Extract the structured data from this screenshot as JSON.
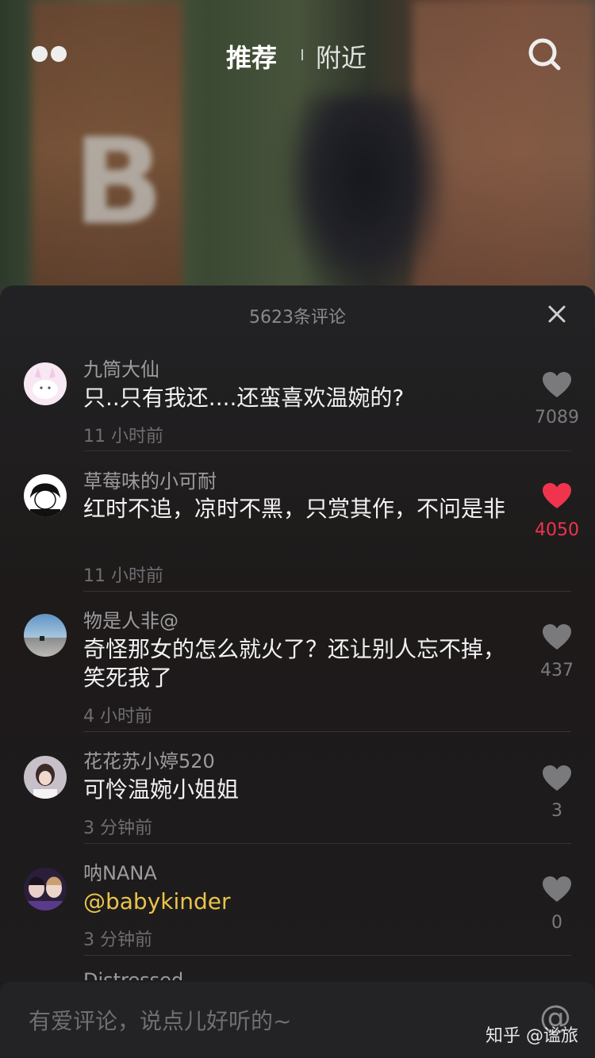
{
  "nav": {
    "tab_recommend": "推荐",
    "tab_nearby": "附近",
    "menu_icon": "dots-icon",
    "search_icon": "search-icon"
  },
  "comments_panel": {
    "title": "5623条评论",
    "close_icon": "close-icon",
    "items": [
      {
        "user": "九筒大仙",
        "text": "只..只有我还....还蛮喜欢温婉的?",
        "time": "11 小时前",
        "likes": "7089",
        "liked": false
      },
      {
        "user": "草莓味的小可耐",
        "text": "红时不追，凉时不黑，只赏其作，不问是非",
        "time": "11 小时前",
        "likes": "4050",
        "liked": true
      },
      {
        "user": "物是人非@",
        "text": "奇怪那女的怎么就火了？还让别人忘不掉，笑死我了",
        "time": "4 小时前",
        "likes": "437",
        "liked": false
      },
      {
        "user": "花花苏小婷520",
        "text": "可怜温婉小姐姐",
        "time": "3 分钟前",
        "likes": "3",
        "liked": false
      },
      {
        "user": "呐NANA",
        "text": "@babykinder",
        "time": "3 分钟前",
        "likes": "0",
        "liked": false
      }
    ],
    "partial_user": "Distressed"
  },
  "input_bar": {
    "placeholder": "有爱评论，说点儿好听的~",
    "at_symbol": "@",
    "watermark": "知乎 @谧旅"
  },
  "colors": {
    "liked_red": "#f0344e",
    "mention_yellow": "#e8c44a",
    "panel_bg": "#222224"
  }
}
